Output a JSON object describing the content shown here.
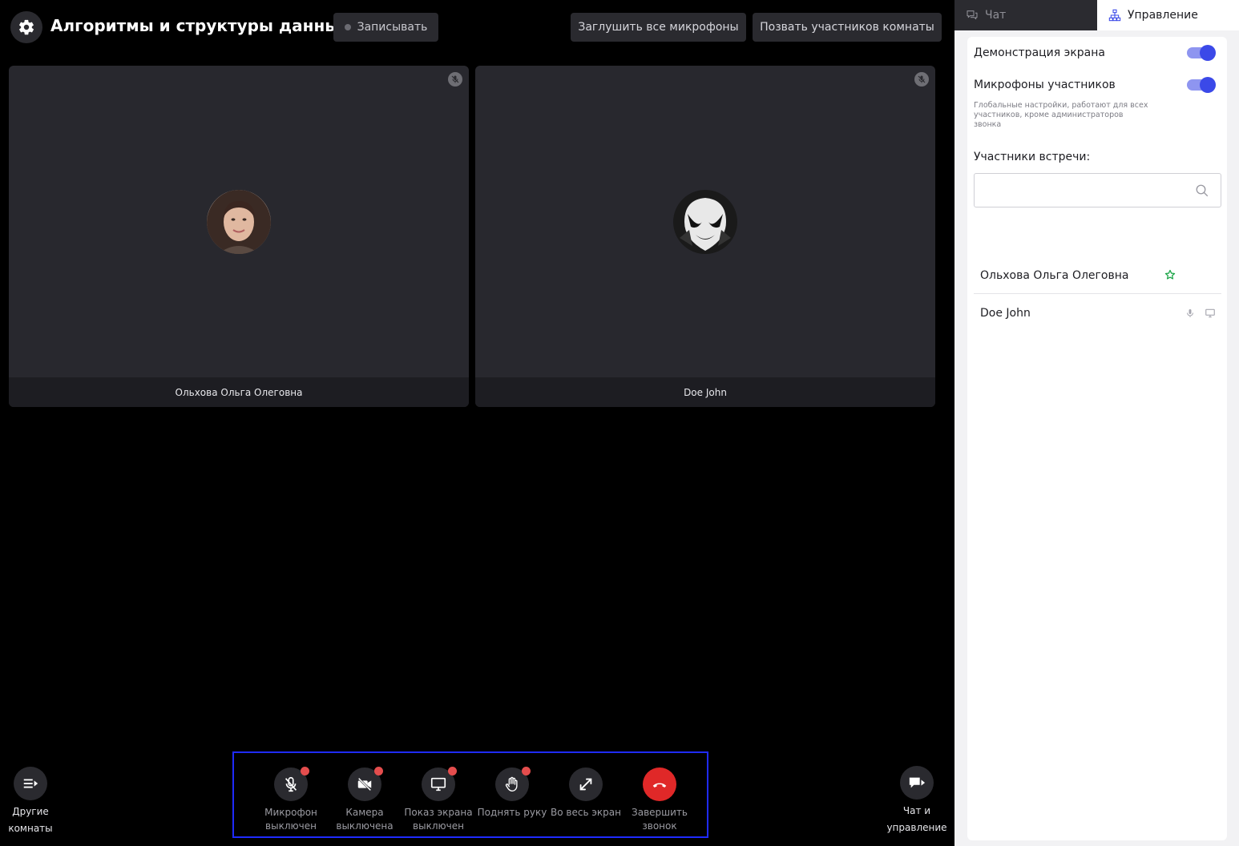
{
  "header": {
    "room_title": "Алгоритмы и структуры данных",
    "record_label": "Записывать",
    "mute_all_label": "Заглушить все микрофоны",
    "invite_label": "Позвать участников комнаты"
  },
  "tiles": [
    {
      "name": "Ольхова Ольга Олеговна",
      "mic_muted": true,
      "avatar": "woman-photo"
    },
    {
      "name": "Doe John",
      "mic_muted": true,
      "avatar": "mask-figure"
    }
  ],
  "controls": {
    "mic": "Микрофон выключен",
    "camera": "Камера выключена",
    "screen": "Показ экрана выключен",
    "hand": "Поднять руку",
    "fullscreen": "Во весь экран",
    "end_call": "Завершить звонок"
  },
  "side_controls": {
    "other_rooms": "Другие комнаты",
    "chat_admin": "Чат и управление"
  },
  "panel": {
    "tabs": {
      "chat": "Чат",
      "admin": "Управление"
    },
    "active_tab": "admin",
    "screen_share_label": "Демонстрация экрана",
    "screen_share_enabled": true,
    "participant_mics_label": "Микрофоны участников",
    "participant_mics_enabled": true,
    "global_note": "Глобальные настройки, работают для всех участников, кроме администраторов звонка",
    "participants_title": "Участники встречи:",
    "search_value": "",
    "participants": [
      {
        "name": "Ольхова Ольга Олеговна",
        "icons": [
          "star-icon"
        ]
      },
      {
        "name": "Doe John",
        "icons": [
          "microphone-icon",
          "monitor-icon"
        ]
      }
    ]
  },
  "colors": {
    "accent": "#3b49e8",
    "end_call": "#e02828",
    "badge": "#e44d4d",
    "highlight_box": "#1f2bff",
    "admin_star": "#1fa64a"
  }
}
